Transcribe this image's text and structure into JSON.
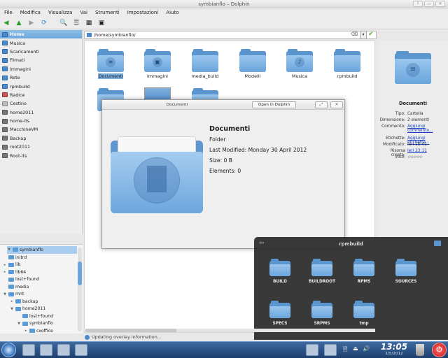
{
  "window": {
    "title": "symbianflo – Dolphin",
    "buttons": [
      "?",
      "▭",
      "✕"
    ]
  },
  "menu": [
    "File",
    "Modifica",
    "Visualizza",
    "Vai",
    "Strumenti",
    "Impostazioni",
    "Aiuto"
  ],
  "toolbar": {
    "back": "◀",
    "up": "▲",
    "forward": "▶",
    "reload": "⟳",
    "search": "🔍",
    "view": "☰",
    "preview": "▦",
    "terminal": "▣"
  },
  "places": [
    {
      "label": "Home",
      "icon": "home-icon",
      "selected": true
    },
    {
      "label": "Musica",
      "icon": "folder-music-icon"
    },
    {
      "label": "Scaricamenti",
      "icon": "folder-downloads-icon"
    },
    {
      "label": "Filmati",
      "icon": "folder-video-icon"
    },
    {
      "label": "Immagini",
      "icon": "folder-images-icon"
    },
    {
      "label": "Rete",
      "icon": "network-icon"
    },
    {
      "label": "rpmbuild",
      "icon": "folder-icon"
    },
    {
      "label": "Radice",
      "icon": "folder-red-icon"
    },
    {
      "label": "Cestino",
      "icon": "trash-icon"
    },
    {
      "label": "home2011",
      "icon": "drive-icon"
    },
    {
      "label": "home-lts",
      "icon": "drive-icon"
    },
    {
      "label": "MacchineVM",
      "icon": "drive-icon"
    },
    {
      "label": "Backup",
      "icon": "drive-icon"
    },
    {
      "label": "root2011",
      "icon": "drive-icon"
    },
    {
      "label": "Root-lts",
      "icon": "drive-icon"
    }
  ],
  "tree": [
    {
      "label": "symbianflo",
      "toggle": "▼",
      "selected": true
    },
    {
      "label": "initrd",
      "toggle": ""
    },
    {
      "label": "lib",
      "toggle": "▸"
    },
    {
      "label": "lib64",
      "toggle": "▸"
    },
    {
      "label": "lost+found",
      "toggle": ""
    },
    {
      "label": "media",
      "toggle": ""
    },
    {
      "label": "mnt",
      "toggle": "▼"
    },
    {
      "label": "backup",
      "toggle": "▸"
    },
    {
      "label": "home2011",
      "toggle": "▼"
    },
    {
      "label": "lost+found",
      "toggle": ""
    },
    {
      "label": "symbianflo",
      "toggle": "▼"
    },
    {
      "label": "cxoffice",
      "toggle": "▸"
    }
  ],
  "location": {
    "path": "/home/symbianflo/",
    "clear_icon": "⌫",
    "drop_icon": "▾",
    "ok_icon": "✔"
  },
  "files": [
    {
      "label": "Documenti",
      "emblem": "≡",
      "selected": true
    },
    {
      "label": "Immagini",
      "emblem": "▣"
    },
    {
      "label": "media_build",
      "emblem": ""
    },
    {
      "label": "Modelli",
      "emblem": ""
    },
    {
      "label": "Musica",
      "emblem": "♪"
    },
    {
      "label": "rpmbuild",
      "emblem": ""
    }
  ],
  "info": {
    "name": "Documenti",
    "rows": [
      {
        "key": "Tipo:",
        "value": "Cartella",
        "link": false
      },
      {
        "key": "Dimensione:",
        "value": "2 elementi",
        "link": false
      },
      {
        "key": "Commento:",
        "value": "Aggiungi commento...",
        "link": true
      },
      {
        "key": "Etichette:",
        "value": "Aggiungi etichette...",
        "link": true
      },
      {
        "key": "Modificato:",
        "value": "Ieri 15:41",
        "link": false
      },
      {
        "key": "Risorsa creata:",
        "value": "Ieri 23:11",
        "link": true
      },
      {
        "key": "Voto:",
        "value": "☆☆☆☆☆",
        "link": false
      }
    ]
  },
  "popup": {
    "title": "Documenti",
    "open_button": "Open in Dolphin",
    "pin_icon": "⤢",
    "close_icon": "✕",
    "name": "Documenti",
    "type": "Folder",
    "modified": "Last Modified: Monday 30 April 2012",
    "size": "Size: 0 B",
    "elements": "Elements: 0"
  },
  "folderview": {
    "title": "rpmbuild",
    "back_icon": "⇦",
    "items": [
      "BUILD",
      "BUILDROOT",
      "RPMS",
      "SOURCES",
      "SPECS",
      "SRPMS",
      "tmp"
    ]
  },
  "status": {
    "text": "Updating overlay information..."
  },
  "taskbar": {
    "time": "13:05",
    "date": "1/5/2012",
    "power_icon": "⏻",
    "tray": [
      "🗎",
      "⏏",
      "🔊"
    ]
  },
  "colors": {
    "accent": "#6aa6dc",
    "folder": "#5b95cd",
    "panel_dark": "#2a2a2a",
    "taskbar": "#1d3f6e"
  }
}
